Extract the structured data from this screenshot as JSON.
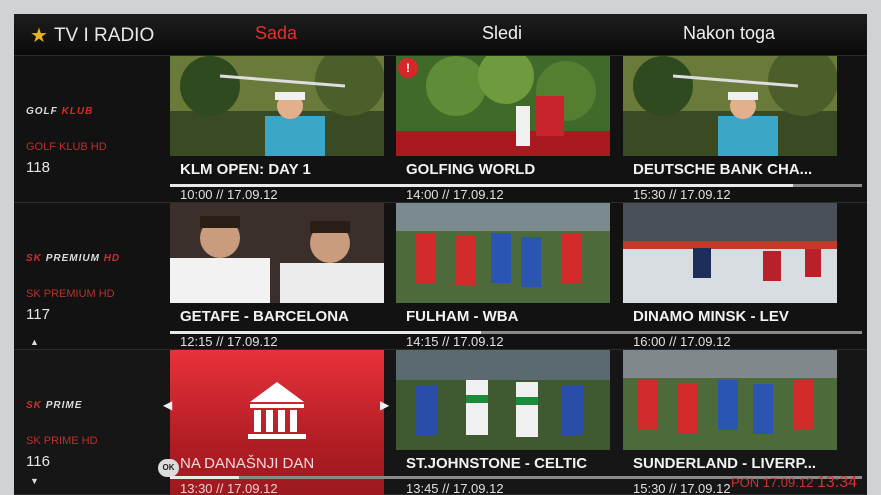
{
  "header": {
    "title": "TV I RADIO",
    "col_now": "Sada",
    "col_next": "Sledi",
    "col_after": "Nakon toga"
  },
  "rows": [
    {
      "channel": {
        "logo": [
          "GOLF",
          "KLUB"
        ],
        "name": "GOLF KLUB HD",
        "number": "118"
      },
      "tiles": [
        {
          "title": "KLM OPEN: DAY 1",
          "time": "10:00 // 17.09.12"
        },
        {
          "title": "GOLFING WORLD",
          "time": "14:00 // 17.09.12"
        },
        {
          "title": "DEUTSCHE BANK CHA...",
          "time": "15:30 // 17.09.12"
        }
      ]
    },
    {
      "channel": {
        "logo": [
          "SK",
          "PREMIUM",
          "HD"
        ],
        "name": "SK PREMIUM HD",
        "number": "117"
      },
      "tiles": [
        {
          "title": "GETAFE - BARCELONA",
          "time": "12:15 // 17.09.12"
        },
        {
          "title": "FULHAM - WBA",
          "time": "14:15 // 17.09.12"
        },
        {
          "title": "DINAMO MINSK - LEV",
          "time": "16:00 // 17.09.12"
        }
      ]
    },
    {
      "channel": {
        "logo": [
          "SK",
          "PRIME"
        ],
        "name": "SK PRIME HD",
        "number": "116"
      },
      "tiles": [
        {
          "title": "NA DANAŠNJI DAN",
          "time": "13:30 // 17.09.12"
        },
        {
          "title": "ST.JOHNSTONE - CELTIC",
          "time": "13:45 // 17.09.12"
        },
        {
          "title": "SUNDERLAND - LIVERP...",
          "time": "15:30 // 17.09.12"
        }
      ]
    }
  ],
  "ok_label": "OK",
  "clock": {
    "date": "PON 17.09.12",
    "time": "13:34"
  },
  "progress": {
    "row1": 0.9,
    "row2": 0.45,
    "row3": 0.1
  },
  "icons": {
    "header": "star-icon",
    "warning": "alert-icon",
    "institution": "bank-icon"
  },
  "colors": {
    "accent": "#e4312b",
    "star": "#e9b020",
    "red_tile": "#c8242c"
  }
}
